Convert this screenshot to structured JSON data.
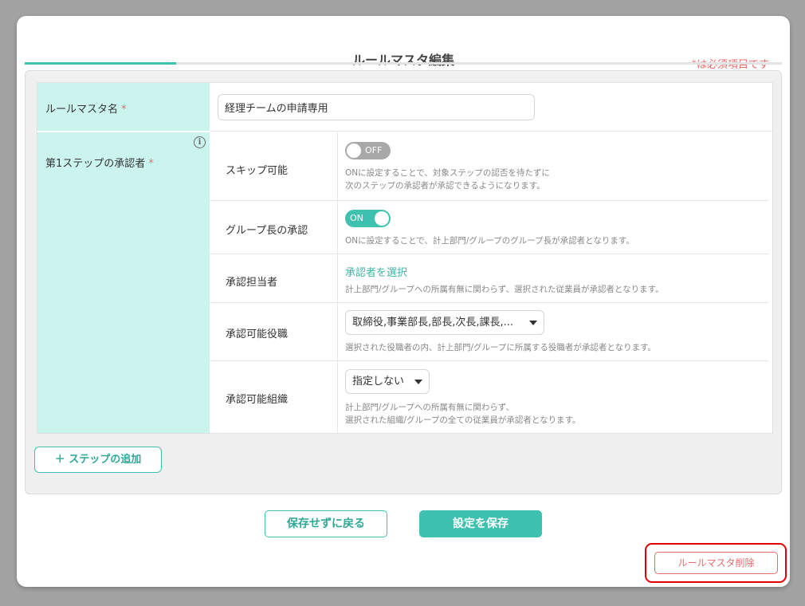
{
  "modal": {
    "title": "ルールマスタ編集",
    "required_note": "*は必須項目です"
  },
  "form": {
    "rule_name": {
      "label": "ルールマスタ名",
      "required_mark": "*",
      "value": "経理チームの申請専用"
    },
    "step1": {
      "label": "第1ステップの承認者",
      "required_mark": "*",
      "info_icon": "info-icon",
      "skip": {
        "label": "スキップ可能",
        "toggle_label": "OFF",
        "toggle_state": "off",
        "desc_line1": "ONに設定することで、対象ステップの認否を待たずに",
        "desc_line2": "次のステップの承認者が承認できるようになります。"
      },
      "group_leader": {
        "label": "グループ長の承認",
        "toggle_label": "ON",
        "toggle_state": "on",
        "desc": "ONに設定することで、計上部門/グループのグループ長が承認者となります。"
      },
      "approver": {
        "label": "承認担当者",
        "link": "承認者を選択",
        "desc": "計上部門/グループへの所属有無に関わらず、選択された従業員が承認者となります。"
      },
      "positions": {
        "label": "承認可能役職",
        "selected": "取締役,事業部長,部長,次長,課長,...",
        "desc": "選択された役職者の内、計上部門/グループに所属する役職者が承認者となります。"
      },
      "organizations": {
        "label": "承認可能組織",
        "selected": "指定しない",
        "desc_line1": "計上部門/グループへの所属有無に関わらず、",
        "desc_line2": "選択された組織/グループの全ての従業員が承認者となります。"
      }
    }
  },
  "actions": {
    "add_step": "＋ ステップの追加",
    "back": "保存せずに戻る",
    "save": "設定を保存",
    "delete": "ルールマスタ削除"
  },
  "colors": {
    "accent": "#3fc1b0",
    "label_bg": "#ccf4ef",
    "required": "#e86b6b",
    "highlight": "#e00000"
  }
}
